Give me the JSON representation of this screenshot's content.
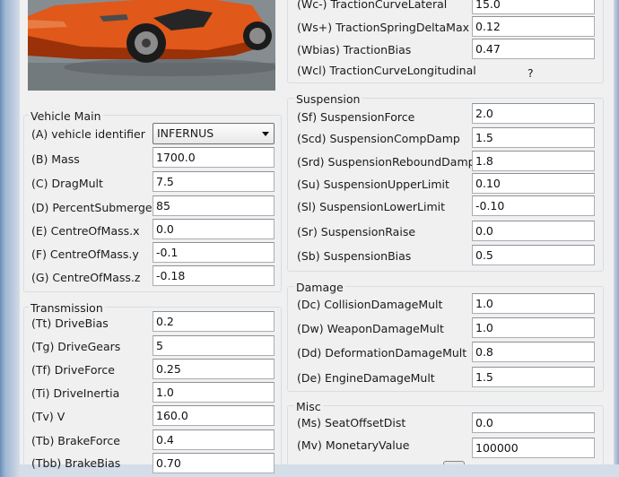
{
  "vehicle_main": {
    "title": "Vehicle Main",
    "rows": [
      {
        "label": "(A) vehicle identifier",
        "value": "INFERNUS"
      },
      {
        "label": "(B) Mass",
        "value": "1700.0"
      },
      {
        "label": "(C) DragMult",
        "value": "7.5"
      },
      {
        "label": "(D) PercentSubmerged",
        "value": "85"
      },
      {
        "label": "(E) CentreOfMass.x",
        "value": "0.0"
      },
      {
        "label": "(F) CentreOfMass.y",
        "value": "-0.1"
      },
      {
        "label": "(G) CentreOfMass.z",
        "value": "-0.18"
      }
    ]
  },
  "transmission": {
    "title": "Transmission",
    "rows": [
      {
        "label": "(Tt) DriveBias",
        "value": "0.2"
      },
      {
        "label": "(Tg) DriveGears",
        "value": "5"
      },
      {
        "label": "(Tf) DriveForce",
        "value": "0.25"
      },
      {
        "label": "(Ti) DriveInertia",
        "value": "1.0"
      },
      {
        "label": "(Tv) V",
        "value": "160.0"
      },
      {
        "label": "(Tb) BrakeForce",
        "value": "0.4"
      },
      {
        "label": "(Tbb) BrakeBias",
        "value": "0.70"
      }
    ]
  },
  "traction": {
    "rows": [
      {
        "label": "(Wc-) TractionCurveLateral",
        "value": "15.0"
      },
      {
        "label": "(Ws+) TractionSpringDeltaMax",
        "value": "0.12"
      },
      {
        "label": "(Wbias) TractionBias",
        "value": "0.47"
      },
      {
        "label": "(Wcl) TractionCurveLongitudinal",
        "value": "?"
      }
    ]
  },
  "suspension": {
    "title": "Suspension",
    "rows": [
      {
        "label": "(Sf) SuspensionForce",
        "value": "2.0"
      },
      {
        "label": "(Scd) SuspensionCompDamp",
        "value": "1.5"
      },
      {
        "label": "(Srd) SuspensionReboundDamp",
        "value": "1.8"
      },
      {
        "label": "(Su) SuspensionUpperLimit",
        "value": "0.10"
      },
      {
        "label": "(Sl) SuspensionLowerLimit",
        "value": "-0.10"
      },
      {
        "label": "(Sr) SuspensionRaise",
        "value": "0.0"
      },
      {
        "label": "(Sb) SuspensionBias",
        "value": "0.5"
      }
    ]
  },
  "damage": {
    "title": "Damage",
    "rows": [
      {
        "label": "(Dc) CollisionDamageMult",
        "value": "1.0"
      },
      {
        "label": "(Dw) WeaponDamageMult",
        "value": "1.0"
      },
      {
        "label": "(Dd) DeformationDamageMult",
        "value": "0.8"
      },
      {
        "label": "(De) EngineDamageMult",
        "value": "1.5"
      }
    ]
  },
  "misc": {
    "title": "Misc",
    "rows": [
      {
        "label": "(Ms) SeatOffsetDist",
        "value": "0.0"
      },
      {
        "label": "(Mv) MonetaryValue",
        "value": "100000"
      }
    ]
  },
  "colors": {
    "car_body": "#e0581a",
    "window_chrome": "#9fb8d4",
    "panel_bg": "#f0f0f0"
  },
  "icons": {
    "combo_arrow": "chevron-down-icon",
    "vehicle_image": "vehicle-preview-image"
  }
}
